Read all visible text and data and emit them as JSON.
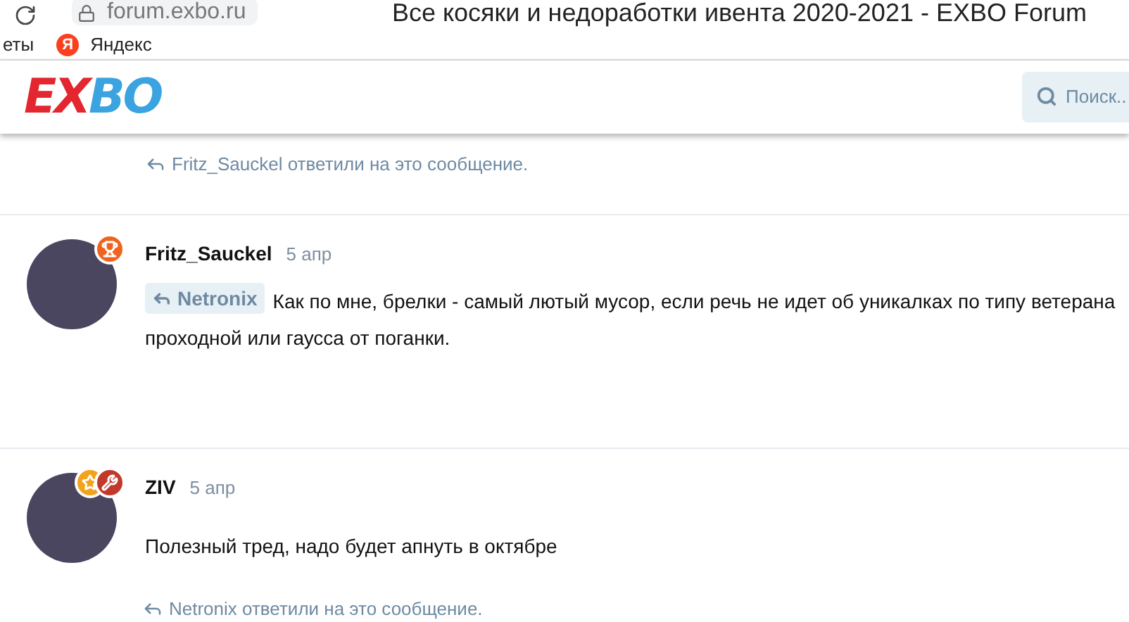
{
  "browser": {
    "url": "forum.exbo.ru",
    "title": "Все косяки и недоработки ивента 2020-2021 - EXBO Forum"
  },
  "bookmarks": [
    {
      "label": "еты",
      "kind": "plain"
    },
    {
      "label": "Яндекс",
      "kind": "yandex",
      "icon_letter": "Я"
    }
  ],
  "header": {
    "logo": "EXBO",
    "search": {
      "placeholder": "Поиск.."
    }
  },
  "posts": [
    {
      "kind": "replies_only",
      "replies_note": "Fritz_Sauckel ответили на это сообщение."
    },
    {
      "kind": "post",
      "author": "Fritz_Sauckel",
      "date": "5 апр",
      "badges": [
        {
          "kind": "trophy",
          "color": "#f0631f"
        }
      ],
      "mention": "Netronix",
      "text": "Как по мне, брелки - самый лютый мусор, если речь не идет об уникалках по типу ветерана проходной или гаусса от поганки."
    },
    {
      "kind": "post",
      "author": "ZIV",
      "date": "5 апр",
      "badges": [
        {
          "kind": "star",
          "color": "#f4a21a"
        },
        {
          "kind": "wrench",
          "color": "#c0392b"
        }
      ],
      "text": "Полезный тред, надо будет апнуть в октябре",
      "replies_note": "Netronix ответили на это сообщение."
    }
  ]
}
